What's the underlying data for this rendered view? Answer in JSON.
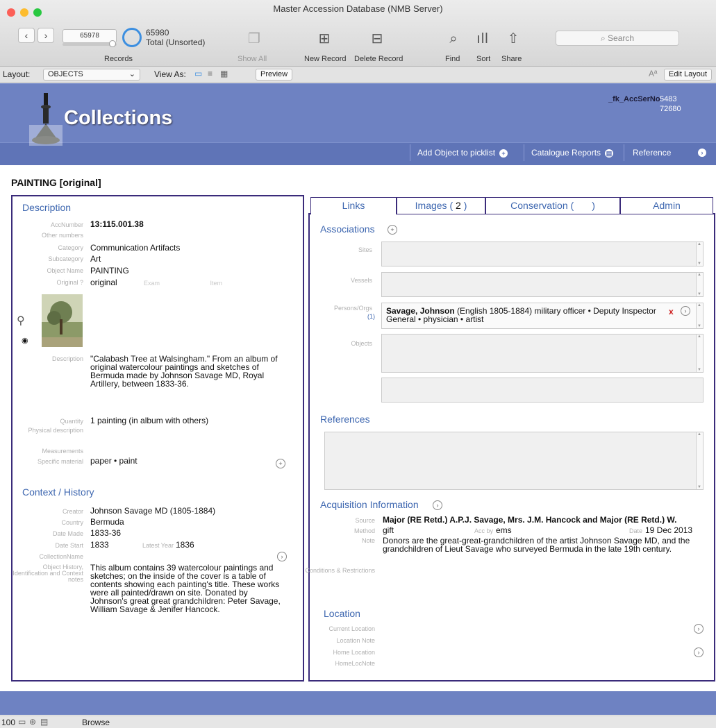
{
  "window": {
    "title": "Master Accession Database (NMB Server)"
  },
  "toolbar": {
    "record_number": "65978",
    "total_count": "65980",
    "total_label": "Total (Unsorted)",
    "records_label": "Records",
    "show_all": "Show All",
    "new_record": "New Record",
    "delete_record": "Delete Record",
    "find": "Find",
    "sort": "Sort",
    "share": "Share",
    "search_placeholder": "Search"
  },
  "layoutbar": {
    "layout_label": "Layout:",
    "layout_value": "OBJECTS",
    "view_as": "View As:",
    "preview": "Preview",
    "edit_layout": "Edit Layout"
  },
  "header": {
    "app_name": "Collections",
    "fk_label": "_fk_AccSerNo",
    "fk_value": "5483",
    "id_value": "72680",
    "add_picklist": "Add Object to picklist",
    "catalogue_reports": "Catalogue Reports",
    "reference": "Reference"
  },
  "record_heading": "PAINTING [original]",
  "description": {
    "section": "Description",
    "acc_label": "AccNumber",
    "acc_value": "13:115.001.38",
    "other_label": "Other numbers",
    "category_label": "Category",
    "category_value": "Communication Artifacts",
    "subcategory_label": "Subcategory",
    "subcategory_value": "Art",
    "objname_label": "Object Name",
    "objname_value": "PAINTING",
    "original_label": "Original ?",
    "original_value": "original",
    "exam_label": "Exam",
    "item_label": "Item",
    "desc_label": "Description",
    "desc_value": "\"Calabash Tree at Walsingham.\" From an album of original watercolour paintings and sketches of Bermuda made by Johnson Savage MD, Royal Artillery, between 1833-36.",
    "quantity_label": "Quantity",
    "quantity_value": "1 painting (in album with others)",
    "physical_label": "Physical description",
    "measurements_label": "Measurements",
    "material_label": "Specific material",
    "material_value": "paper • paint"
  },
  "context": {
    "section": "Context / History",
    "creator_label": "Creator",
    "creator_value": "Johnson Savage MD (1805-1884)",
    "country_label": "Country",
    "country_value": "Bermuda",
    "datemade_label": "Date Made",
    "datemade_value": "1833-36",
    "datestart_label": "Date Start",
    "datestart_value": "1833",
    "latest_label": "Latest Year",
    "latest_value": "1836",
    "collection_label": "CollectionName",
    "history_label": "Object History, Identification and Context notes",
    "history_value": "This album contains 39 watercolour paintings and sketches; on the inside of the cover is a table of contents showing each painting's title. These works were all painted/drawn on site. Donated by Johnson's great great grandchildren: Peter Savage, William Savage & Jenifer Hancock."
  },
  "tabs": {
    "links": "Links",
    "images": "Images (",
    "images_count": "2",
    "images_close": ")",
    "conservation": "Conservation (",
    "conservation_close": ")",
    "admin": "Admin"
  },
  "associations": {
    "section": "Associations",
    "sites_label": "Sites",
    "vessels_label": "Vessels",
    "persons_label": "Persons/Orgs",
    "persons_count": "(1)",
    "person_name": "Savage, Johnson",
    "person_detail": "(English 1805-1884) military officer • Deputy Inspector General • physician • artist",
    "remove_mark": "x",
    "objects_label": "Objects"
  },
  "references": {
    "section": "References"
  },
  "acquisition": {
    "section": "Acquisition Information",
    "source_label": "Source",
    "source_value": "Major (RE Retd.) A.P.J. Savage, Mrs. J.M. Hancock and Major (RE Retd.) W.",
    "method_label": "Method",
    "method_value": "gift",
    "accby_label": "Acc by",
    "accby_value": "ems",
    "date_label": "Date",
    "date_value": "19 Dec 2013",
    "note_label": "Note",
    "note_value": "Donors are the great-great-grandchildren of the artist Johnson Savage MD, and the grandchildren of Lieut Savage who surveyed Bermuda in the late 19th century.",
    "conditions_label": "Conditions & Restrictions"
  },
  "location": {
    "section": "Location",
    "current_label": "Current Location",
    "locnote_label": "Location Note",
    "home_label": "Home Location",
    "homenote_label": "HomeLocNote"
  },
  "statusbar": {
    "zoom": "100",
    "mode": "Browse"
  },
  "colors": {
    "header_blue": "#6e82c2",
    "panel_border": "#3a2b7a",
    "section_blue": "#3e67b0"
  }
}
